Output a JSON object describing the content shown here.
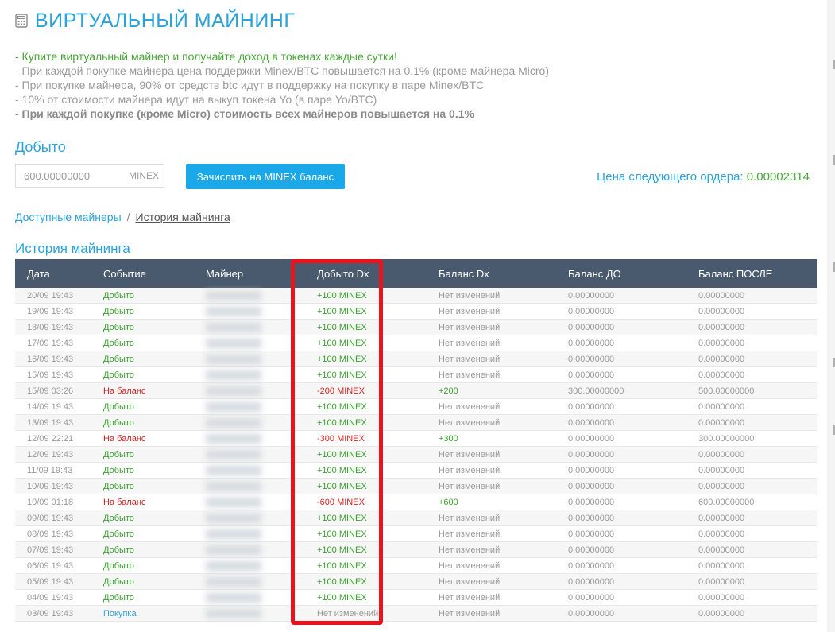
{
  "page": {
    "title": "ВИРТУАЛЬНЫЙ МАЙНИНГ",
    "icon": "calculator-icon"
  },
  "info": {
    "line1": "- Купите виртуальный майнер и получайте доход в токенах каждые сутки!",
    "line2": "- При каждой покупке майнера цена поддержки Minex/BTC повышается на 0.1% (кроме майнера Micro)",
    "line3": "- При покупке майнера, 90% от средств btc идут в поддержку на покупку в паре Minex/BTC",
    "line4": "- 10% от стоимости майнера идут на выкуп токена Yo (в паре Yo/BTC)",
    "line5": "- При каждой покупке (кроме Micro) стоимость всех майнеров повышается на 0.1%"
  },
  "mined": {
    "heading": "Добыто",
    "placeholder": "600.00000000",
    "unit": "MINEX",
    "button_label": "Зачислить на MINEX баланс",
    "next_price_label": "Цена следующего ордера:",
    "next_price_value": "0.00002314"
  },
  "breadcrumb": {
    "link": "Доступные майнеры",
    "separator": "/",
    "current": "История майнинга"
  },
  "history": {
    "heading": "История майнинга",
    "columns": [
      "Дата",
      "Событие",
      "Майнер",
      "Добыто Dx",
      "Баланс Dx",
      "Баланс ДО",
      "Баланс ПОСЛЕ"
    ],
    "rows": [
      {
        "date": "20/09 19:43",
        "event": "Добыто",
        "event_type": "mined",
        "mined": "+100 MINEX",
        "mined_type": "plus",
        "balance_dx": "Нет изменений",
        "balance_dx_type": "none",
        "before": "0.00000000",
        "after": "0.00000000"
      },
      {
        "date": "19/09 19:43",
        "event": "Добыто",
        "event_type": "mined",
        "mined": "+100 MINEX",
        "mined_type": "plus",
        "balance_dx": "Нет изменений",
        "balance_dx_type": "none",
        "before": "0.00000000",
        "after": "0.00000000"
      },
      {
        "date": "18/09 19:43",
        "event": "Добыто",
        "event_type": "mined",
        "mined": "+100 MINEX",
        "mined_type": "plus",
        "balance_dx": "Нет изменений",
        "balance_dx_type": "none",
        "before": "0.00000000",
        "after": "0.00000000"
      },
      {
        "date": "17/09 19:43",
        "event": "Добыто",
        "event_type": "mined",
        "mined": "+100 MINEX",
        "mined_type": "plus",
        "balance_dx": "Нет изменений",
        "balance_dx_type": "none",
        "before": "0.00000000",
        "after": "0.00000000"
      },
      {
        "date": "16/09 19:43",
        "event": "Добыто",
        "event_type": "mined",
        "mined": "+100 MINEX",
        "mined_type": "plus",
        "balance_dx": "Нет изменений",
        "balance_dx_type": "none",
        "before": "0.00000000",
        "after": "0.00000000"
      },
      {
        "date": "15/09 19:43",
        "event": "Добыто",
        "event_type": "mined",
        "mined": "+100 MINEX",
        "mined_type": "plus",
        "balance_dx": "Нет изменений",
        "balance_dx_type": "none",
        "before": "0.00000000",
        "after": "0.00000000"
      },
      {
        "date": "15/09 03:26",
        "event": "На баланс",
        "event_type": "to_balance",
        "mined": "-200 MINEX",
        "mined_type": "minus",
        "balance_dx": "+200",
        "balance_dx_type": "plus",
        "before": "300.00000000",
        "after": "500.00000000"
      },
      {
        "date": "14/09 19:43",
        "event": "Добыто",
        "event_type": "mined",
        "mined": "+100 MINEX",
        "mined_type": "plus",
        "balance_dx": "Нет изменений",
        "balance_dx_type": "none",
        "before": "0.00000000",
        "after": "0.00000000"
      },
      {
        "date": "13/09 19:43",
        "event": "Добыто",
        "event_type": "mined",
        "mined": "+100 MINEX",
        "mined_type": "plus",
        "balance_dx": "Нет изменений",
        "balance_dx_type": "none",
        "before": "0.00000000",
        "after": "0.00000000"
      },
      {
        "date": "12/09 22:21",
        "event": "На баланс",
        "event_type": "to_balance",
        "mined": "-300 MINEX",
        "mined_type": "minus",
        "balance_dx": "+300",
        "balance_dx_type": "plus",
        "before": "0.00000000",
        "after": "300.00000000"
      },
      {
        "date": "12/09 19:43",
        "event": "Добыто",
        "event_type": "mined",
        "mined": "+100 MINEX",
        "mined_type": "plus",
        "balance_dx": "Нет изменений",
        "balance_dx_type": "none",
        "before": "0.00000000",
        "after": "0.00000000"
      },
      {
        "date": "11/09 19:43",
        "event": "Добыто",
        "event_type": "mined",
        "mined": "+100 MINEX",
        "mined_type": "plus",
        "balance_dx": "Нет изменений",
        "balance_dx_type": "none",
        "before": "0.00000000",
        "after": "0.00000000"
      },
      {
        "date": "10/09 19:43",
        "event": "Добыто",
        "event_type": "mined",
        "mined": "+100 MINEX",
        "mined_type": "plus",
        "balance_dx": "Нет изменений",
        "balance_dx_type": "none",
        "before": "0.00000000",
        "after": "0.00000000"
      },
      {
        "date": "10/09 01:18",
        "event": "На баланс",
        "event_type": "to_balance",
        "mined": "-600 MINEX",
        "mined_type": "minus",
        "balance_dx": "+600",
        "balance_dx_type": "plus",
        "before": "0.00000000",
        "after": "600.00000000"
      },
      {
        "date": "09/09 19:43",
        "event": "Добыто",
        "event_type": "mined",
        "mined": "+100 MINEX",
        "mined_type": "plus",
        "balance_dx": "Нет изменений",
        "balance_dx_type": "none",
        "before": "0.00000000",
        "after": "0.00000000"
      },
      {
        "date": "08/09 19:43",
        "event": "Добыто",
        "event_type": "mined",
        "mined": "+100 MINEX",
        "mined_type": "plus",
        "balance_dx": "Нет изменений",
        "balance_dx_type": "none",
        "before": "0.00000000",
        "after": "0.00000000"
      },
      {
        "date": "07/09 19:43",
        "event": "Добыто",
        "event_type": "mined",
        "mined": "+100 MINEX",
        "mined_type": "plus",
        "balance_dx": "Нет изменений",
        "balance_dx_type": "none",
        "before": "0.00000000",
        "after": "0.00000000"
      },
      {
        "date": "06/09 19:43",
        "event": "Добыто",
        "event_type": "mined",
        "mined": "+100 MINEX",
        "mined_type": "plus",
        "balance_dx": "Нет изменений",
        "balance_dx_type": "none",
        "before": "0.00000000",
        "after": "0.00000000"
      },
      {
        "date": "05/09 19:43",
        "event": "Добыто",
        "event_type": "mined",
        "mined": "+100 MINEX",
        "mined_type": "plus",
        "balance_dx": "Нет изменений",
        "balance_dx_type": "none",
        "before": "0.00000000",
        "after": "0.00000000"
      },
      {
        "date": "04/09 19:43",
        "event": "Добыто",
        "event_type": "mined",
        "mined": "+100 MINEX",
        "mined_type": "plus",
        "balance_dx": "Нет изменений",
        "balance_dx_type": "none",
        "before": "0.00000000",
        "after": "0.00000000"
      },
      {
        "date": "03/09 19:43",
        "event": "Покупка",
        "event_type": "purchase",
        "mined": "Нет изменений",
        "mined_type": "none",
        "balance_dx": "Нет изменений",
        "balance_dx_type": "none",
        "before": "0.00000000",
        "after": "0.00000000"
      }
    ]
  },
  "colors": {
    "accent": "#2aa3d8",
    "positive": "#3aa12e",
    "negative": "#d9201f",
    "header_bg": "#4a5a6e",
    "button_bg": "#1aa8e8",
    "highlight": "#e8131c"
  }
}
